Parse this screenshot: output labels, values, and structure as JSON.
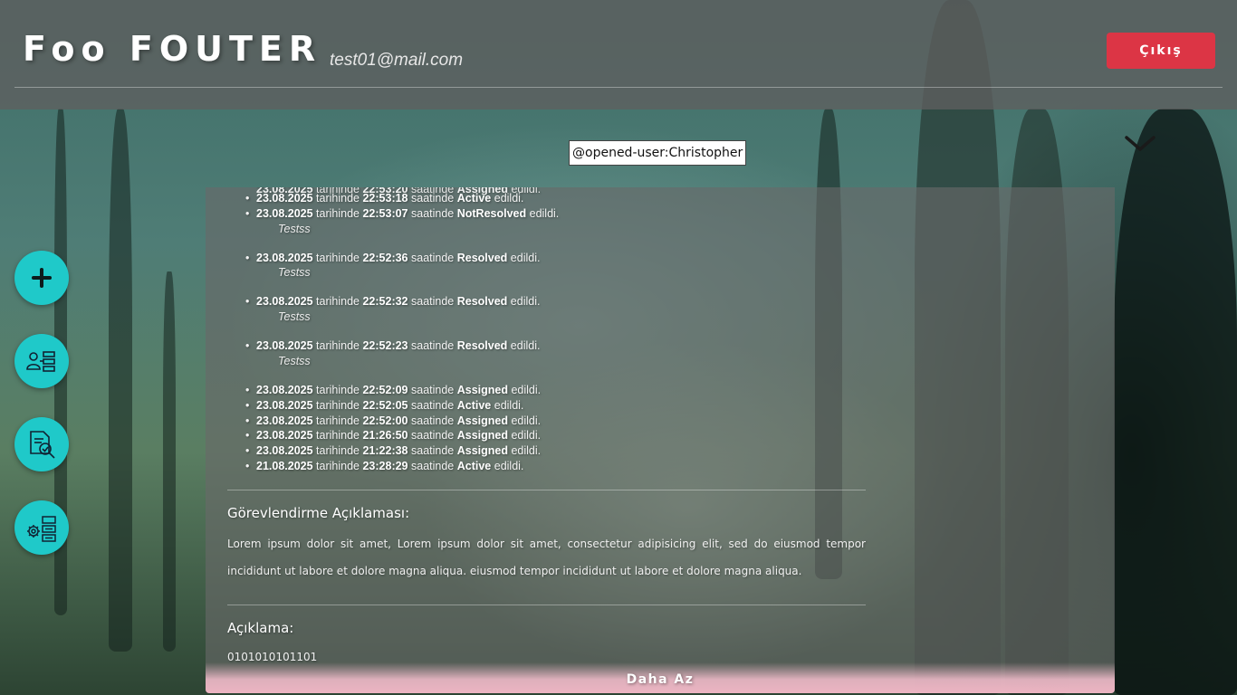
{
  "header": {
    "brand": "Foo FOUTER",
    "email": "test01@mail.com",
    "logout_label": "Çıkış"
  },
  "tooltip": "@opened-user:Christopher",
  "fabs": [
    {
      "icon": "plus-icon"
    },
    {
      "icon": "user-assign-icon"
    },
    {
      "icon": "document-search-icon"
    },
    {
      "icon": "settings-workflow-icon"
    }
  ],
  "log": {
    "word_tarihinde": "tarihinde",
    "word_saatinde": "saatinde",
    "word_edildi": "edildi.",
    "entries": [
      {
        "date": "23.08.2025",
        "time": "22:53:18",
        "status": "Active",
        "note": ""
      },
      {
        "date": "23.08.2025",
        "time": "22:53:07",
        "status": "NotResolved",
        "note": "Testss"
      },
      {
        "date": "23.08.2025",
        "time": "22:52:36",
        "status": "Resolved",
        "note": "Testss"
      },
      {
        "date": "23.08.2025",
        "time": "22:52:32",
        "status": "Resolved",
        "note": "Testss"
      },
      {
        "date": "23.08.2025",
        "time": "22:52:23",
        "status": "Resolved",
        "note": "Testss"
      },
      {
        "date": "23.08.2025",
        "time": "22:52:09",
        "status": "Assigned",
        "note": ""
      },
      {
        "date": "23.08.2025",
        "time": "22:52:05",
        "status": "Active",
        "note": ""
      },
      {
        "date": "23.08.2025",
        "time": "22:52:00",
        "status": "Assigned",
        "note": ""
      },
      {
        "date": "23.08.2025",
        "time": "21:26:50",
        "status": "Assigned",
        "note": ""
      },
      {
        "date": "23.08.2025",
        "time": "21:22:38",
        "status": "Assigned",
        "note": ""
      },
      {
        "date": "21.08.2025",
        "time": "23:28:29",
        "status": "Active",
        "note": ""
      }
    ]
  },
  "assignment": {
    "title": "Görevlendirme Açıklaması:",
    "text": "Lorem ipsum dolor sit amet, Lorem ipsum dolor sit amet, consectetur adipisicing elit, sed do eiusmod tempor incididunt ut labore et dolore magna aliqua. eiusmod tempor incididunt ut labore et dolore magna aliqua."
  },
  "description": {
    "title": "Açıklama:",
    "text": "0101010101101"
  },
  "less_label": "Daha Az",
  "colors": {
    "logout": "#dc3545",
    "fab": "#1fc9c9"
  }
}
